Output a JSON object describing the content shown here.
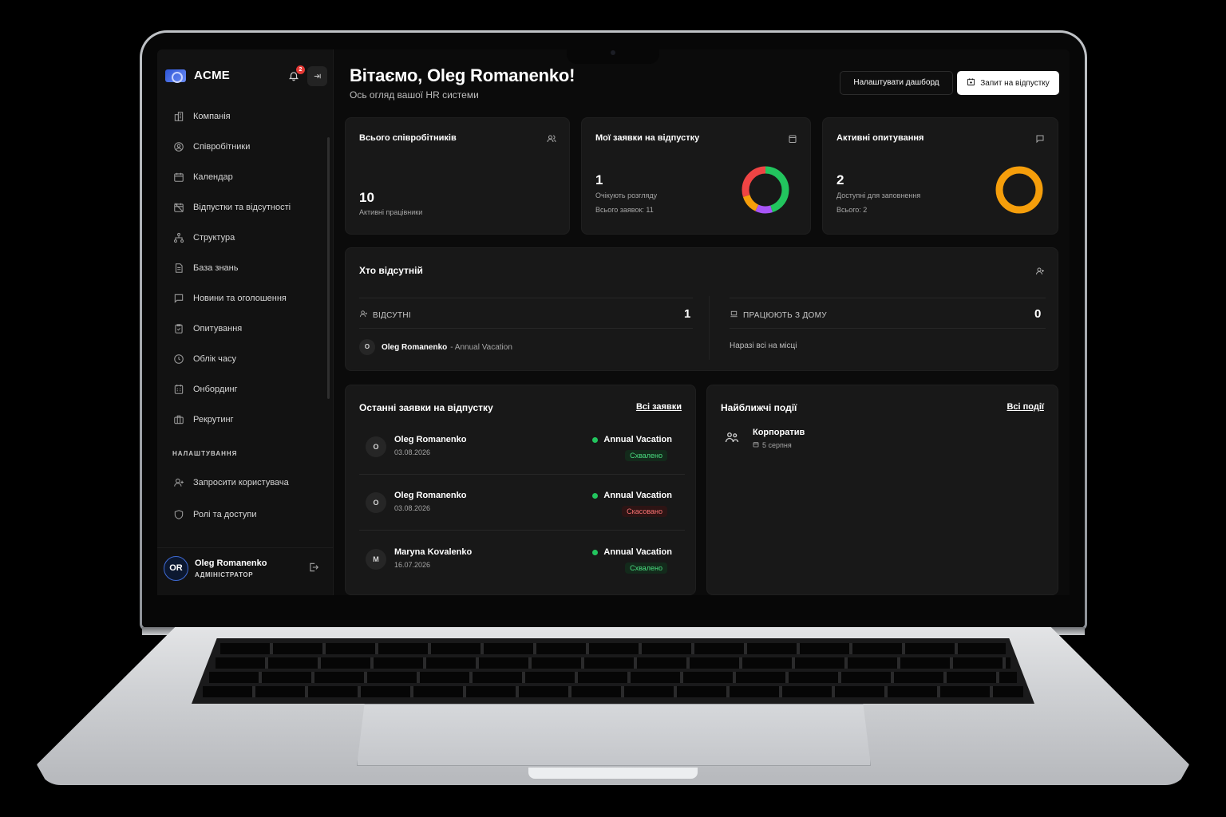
{
  "app": {
    "brand": "ACME",
    "notifications_count": "2"
  },
  "sidebar": {
    "items": [
      {
        "label": "Компанія",
        "icon": "building-icon"
      },
      {
        "label": "Співробітники",
        "icon": "user-circle-icon"
      },
      {
        "label": "Календар",
        "icon": "calendar-icon"
      },
      {
        "label": "Відпустки та відсутності",
        "icon": "calendar-off-icon"
      },
      {
        "label": "Структура",
        "icon": "org-structure-icon"
      },
      {
        "label": "База знань",
        "icon": "document-icon"
      },
      {
        "label": "Новини та оголошення",
        "icon": "message-icon"
      },
      {
        "label": "Опитування",
        "icon": "clipboard-check-icon"
      },
      {
        "label": "Облік часу",
        "icon": "clock-icon"
      },
      {
        "label": "Онбординг",
        "icon": "calendar-grid-icon"
      },
      {
        "label": "Рекрутинг",
        "icon": "briefcase-icon"
      }
    ],
    "settings_title": "НАЛАШТУВАННЯ",
    "settings_items": [
      {
        "label": "Запросити користувача",
        "icon": "user-plus-icon"
      },
      {
        "label": "Ролі та доступи",
        "icon": "shield-icon"
      }
    ],
    "user": {
      "initials": "OR",
      "name": "Oleg Romanenko",
      "role": "АДМІНІСТРАТОР"
    }
  },
  "header": {
    "greeting": "Вітаємо, Oleg Romanenko!",
    "subtitle": "Ось огляд вашої HR системи",
    "customize_label": "Налаштувати дашборд",
    "request_label": "Запит на відпустку"
  },
  "stats": {
    "employees": {
      "title": "Всього співробітників",
      "value": "10",
      "caption": "Активні працівники"
    },
    "my_requests": {
      "title": "Мої заявки на відпустку",
      "value": "1",
      "caption": "Очікують розгляду",
      "total": "Всього заявок: 11",
      "ring_segments": [
        {
          "share": 0.45,
          "color": "#22c55e"
        },
        {
          "share": 0.12,
          "color": "#a855f7"
        },
        {
          "share": 0.13,
          "color": "#f59e0b"
        },
        {
          "share": 0.3,
          "color": "#ef4444"
        }
      ]
    },
    "surveys": {
      "title": "Активні опитування",
      "value": "2",
      "caption": "Доступні для заповнення",
      "total": "Всього: 2",
      "ring_color": "#f59e0b"
    }
  },
  "absent": {
    "title": "Хто відсутній",
    "absent_label": "ВІДСУТНІ",
    "absent_count": "1",
    "absent_people": [
      {
        "initial": "O",
        "name": "Oleg Romanenko",
        "reason": "- Annual Vacation"
      }
    ],
    "remote_label": "ПРАЦЮЮТЬ З ДОМУ",
    "remote_count": "0",
    "remote_empty": "Наразі всі на місці"
  },
  "requests": {
    "title": "Останні заявки на відпустку",
    "all_link": "Всі заявки",
    "rows": [
      {
        "initial": "O",
        "name": "Oleg Romanenko",
        "date": "03.08.2026",
        "type": "Annual Vacation",
        "status": "Схвалено",
        "status_kind": "approved"
      },
      {
        "initial": "O",
        "name": "Oleg Romanenko",
        "date": "03.08.2026",
        "type": "Annual Vacation",
        "status": "Скасовано",
        "status_kind": "cancelled"
      },
      {
        "initial": "M",
        "name": "Maryna Kovalenko",
        "date": "16.07.2026",
        "type": "Annual Vacation",
        "status": "Схвалено",
        "status_kind": "approved"
      }
    ]
  },
  "events": {
    "title": "Найближчі події",
    "all_link": "Всі події",
    "items": [
      {
        "name": "Корпоратив",
        "date": "5 серпня",
        "icon": "people-icon"
      }
    ]
  },
  "colors": {
    "accent": "#3f6bd6",
    "success": "#22c55e",
    "danger": "#ef4444",
    "warning": "#f59e0b"
  }
}
